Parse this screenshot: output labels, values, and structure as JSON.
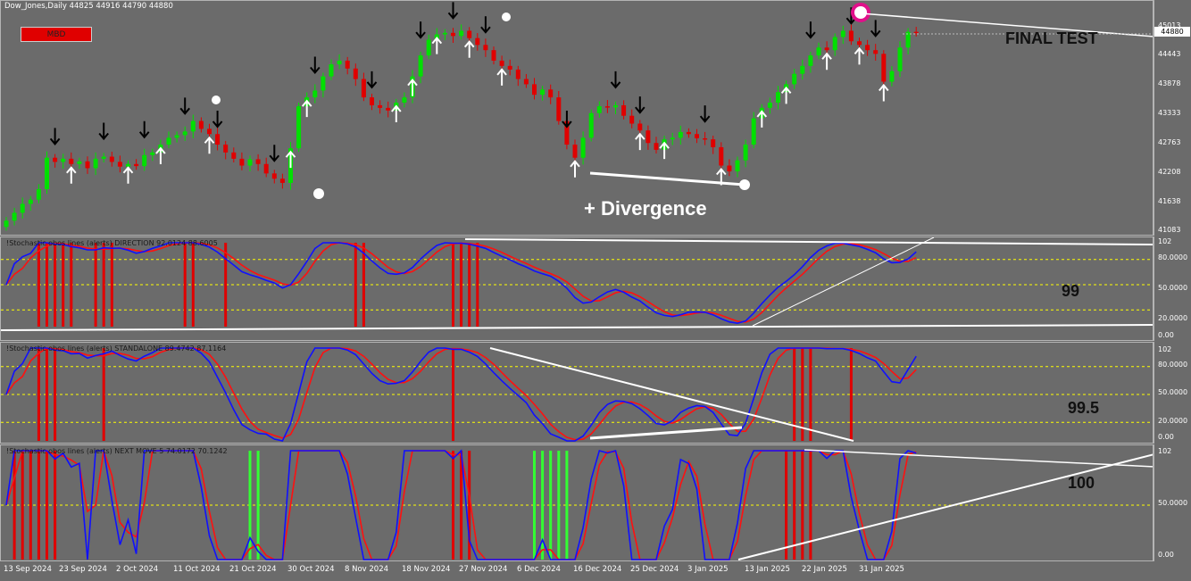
{
  "main": {
    "header": "Dow_Jones,Daily  44825 44916 44790 44880",
    "badge": "MBD",
    "final_test": "FINAL TEST",
    "divergence": "+ Divergence",
    "current_price": "44880",
    "price_ticks": [
      "45013",
      "44443",
      "43878",
      "43333",
      "42763",
      "42208",
      "41638",
      "41083"
    ]
  },
  "osc1": {
    "title": "!Stochastic obos lines (alerts) DIRECTION 92.0124 88.6005",
    "note": "99",
    "levels": [
      "102",
      "80.0000",
      "50.0000",
      "20.0000",
      "0.00"
    ]
  },
  "osc2": {
    "title": "!Stochastic obos lines (alerts) STANDALONE 89.4742 87.1164",
    "note": "99.5",
    "levels": [
      "102",
      "80.0000",
      "50.0000",
      "20.0000",
      "0.00"
    ]
  },
  "osc3": {
    "title": "!Stochastic obos lines (alerts) NEXT MOVE 5 74.0172 70.1242",
    "note": "100",
    "levels": [
      "102",
      "50.0000",
      "0.00"
    ]
  },
  "x_labels": [
    "13 Sep 2024",
    "23 Sep 2024",
    "2 Oct 2024",
    "11 Oct 2024",
    "21 Oct 2024",
    "30 Oct 2024",
    "8 Nov 2024",
    "18 Nov 2024",
    "27 Nov 2024",
    "6 Dec 2024",
    "16 Dec 2024",
    "25 Dec 2024",
    "3 Jan 2025",
    "13 Jan 2025",
    "22 Jan 2025",
    "31 Jan 2025"
  ],
  "colors": {
    "bull": "#00e000",
    "bear": "#e00000",
    "k": "#1010ff",
    "d": "#ff1010",
    "level": "#ffff00",
    "signal_red": "#e00000",
    "signal_green": "#33ff33"
  },
  "chart_data": {
    "type": "line",
    "closes": [
      41300,
      41450,
      41620,
      41700,
      41900,
      42500,
      42420,
      42480,
      42380,
      42430,
      42300,
      42480,
      42520,
      42420,
      42330,
      42380,
      42340,
      42550,
      42600,
      42750,
      42880,
      42930,
      43000,
      43200,
      43050,
      42950,
      42750,
      42600,
      42480,
      42350,
      42470,
      42380,
      42200,
      42100,
      42020,
      42680,
      43480,
      43650,
      43780,
      44050,
      44280,
      44350,
      44200,
      44000,
      43650,
      43500,
      43450,
      43400,
      43550,
      43650,
      44050,
      44450,
      44750,
      44850,
      44880,
      44820,
      44920,
      44780,
      44650,
      44550,
      44350,
      44250,
      44180,
      44000,
      43900,
      43700,
      43800,
      43650,
      43200,
      42750,
      42500,
      42880,
      43350,
      43480,
      43460,
      43500,
      43300,
      43150,
      43020,
      42780,
      42650,
      42850,
      42880,
      42990,
      42950,
      42870,
      42850,
      42700,
      42350,
      42240,
      42450,
      42750,
      43250,
      43450,
      43550,
      43750,
      43900,
      44100,
      44250,
      44450,
      44600,
      44550,
      44800,
      44920,
      44720,
      44650,
      44550,
      44480,
      43950,
      44150,
      44600,
      44900,
      44880
    ]
  }
}
